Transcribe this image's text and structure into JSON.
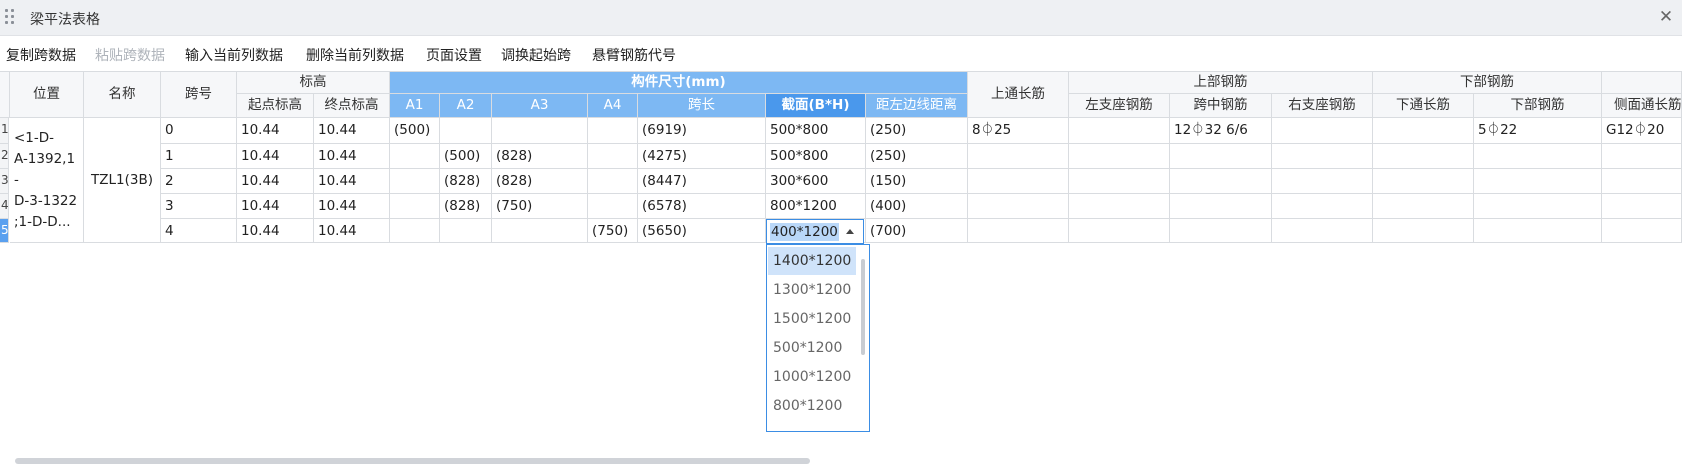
{
  "window": {
    "title": "梁平法表格",
    "close_icon": "close-icon"
  },
  "toolbar": {
    "items": [
      {
        "label": "复制跨数据",
        "enabled": true
      },
      {
        "label": "粘贴跨数据",
        "enabled": false
      },
      {
        "label": "输入当前列数据",
        "enabled": true
      },
      {
        "label": "删除当前列数据",
        "enabled": true
      },
      {
        "label": "页面设置",
        "enabled": true
      },
      {
        "label": "调换起始跨",
        "enabled": true
      },
      {
        "label": "悬臂钢筋代号",
        "enabled": true
      }
    ]
  },
  "table": {
    "group_headers": {
      "position": "位置",
      "name": "名称",
      "span_no": "跨号",
      "elevation": "标高",
      "dimensions": "构件尺寸(mm)",
      "top_through": "上通长筋",
      "top_rebar": "上部钢筋",
      "bottom_rebar": "下部钢筋"
    },
    "sub_headers": {
      "start_elev": "起点标高",
      "end_elev": "终点标高",
      "a1": "A1",
      "a2": "A2",
      "a3": "A3",
      "a4": "A4",
      "span_len": "跨长",
      "section": "截面(B*H)",
      "left_dist": "距左边线距离",
      "left_support": "左支座钢筋",
      "mid_span": "跨中钢筋",
      "right_support": "右支座钢筋",
      "bottom_through": "下通长筋",
      "bottom_bars": "下部钢筋",
      "side_through": "侧面通长筋"
    },
    "row_numbers": [
      "1",
      "2",
      "3",
      "4",
      "5"
    ],
    "active_row": 4,
    "position_value": "<1-D-\nA-1392,1\n-\nD-3-1322\n;1-D-D...",
    "name_value": "TZL1(3B)",
    "rows": [
      {
        "span": "0",
        "start": "10.44",
        "end": "10.44",
        "a1": "(500)",
        "a2": "",
        "a3": "",
        "a4": "",
        "len": "(6919)",
        "section": "500*800",
        "dist": "(250)",
        "top_through": "8⏀25",
        "left_support": "",
        "mid": "12⏀32 6/6",
        "right_support": "",
        "bot_through": "",
        "bot": "5⏀22",
        "side": "G12⏀20"
      },
      {
        "span": "1",
        "start": "10.44",
        "end": "10.44",
        "a1": "",
        "a2": "(500)",
        "a3": "(828)",
        "a4": "",
        "len": "(4275)",
        "section": "500*800",
        "dist": "(250)",
        "top_through": "",
        "left_support": "",
        "mid": "",
        "right_support": "",
        "bot_through": "",
        "bot": "",
        "side": ""
      },
      {
        "span": "2",
        "start": "10.44",
        "end": "10.44",
        "a1": "",
        "a2": "(828)",
        "a3": "(828)",
        "a4": "",
        "len": "(8447)",
        "section": "300*600",
        "dist": "(150)",
        "top_through": "",
        "left_support": "",
        "mid": "",
        "right_support": "",
        "bot_through": "",
        "bot": "",
        "side": ""
      },
      {
        "span": "3",
        "start": "10.44",
        "end": "10.44",
        "a1": "",
        "a2": "(828)",
        "a3": "(750)",
        "a4": "",
        "len": "(6578)",
        "section": "800*1200",
        "dist": "(400)",
        "top_through": "",
        "left_support": "",
        "mid": "",
        "right_support": "",
        "bot_through": "",
        "bot": "",
        "side": ""
      },
      {
        "span": "4",
        "start": "10.44",
        "end": "10.44",
        "a1": "",
        "a2": "",
        "a3": "",
        "a4": "(750)",
        "len": "(5650)",
        "section": "",
        "dist": "(700)",
        "top_through": "",
        "left_support": "",
        "mid": "",
        "right_support": "",
        "bot_through": "",
        "bot": "",
        "side": ""
      }
    ]
  },
  "editor": {
    "value": "400*1200",
    "options": [
      "1400*1200",
      "1300*1200",
      "1500*1200",
      "500*1200",
      "1000*1200",
      "800*1200"
    ],
    "highlighted_index": 0
  },
  "colors": {
    "header_blue": "#7db8f3",
    "header_blue_selected": "#4a98ec",
    "accent": "#3b8de4"
  }
}
